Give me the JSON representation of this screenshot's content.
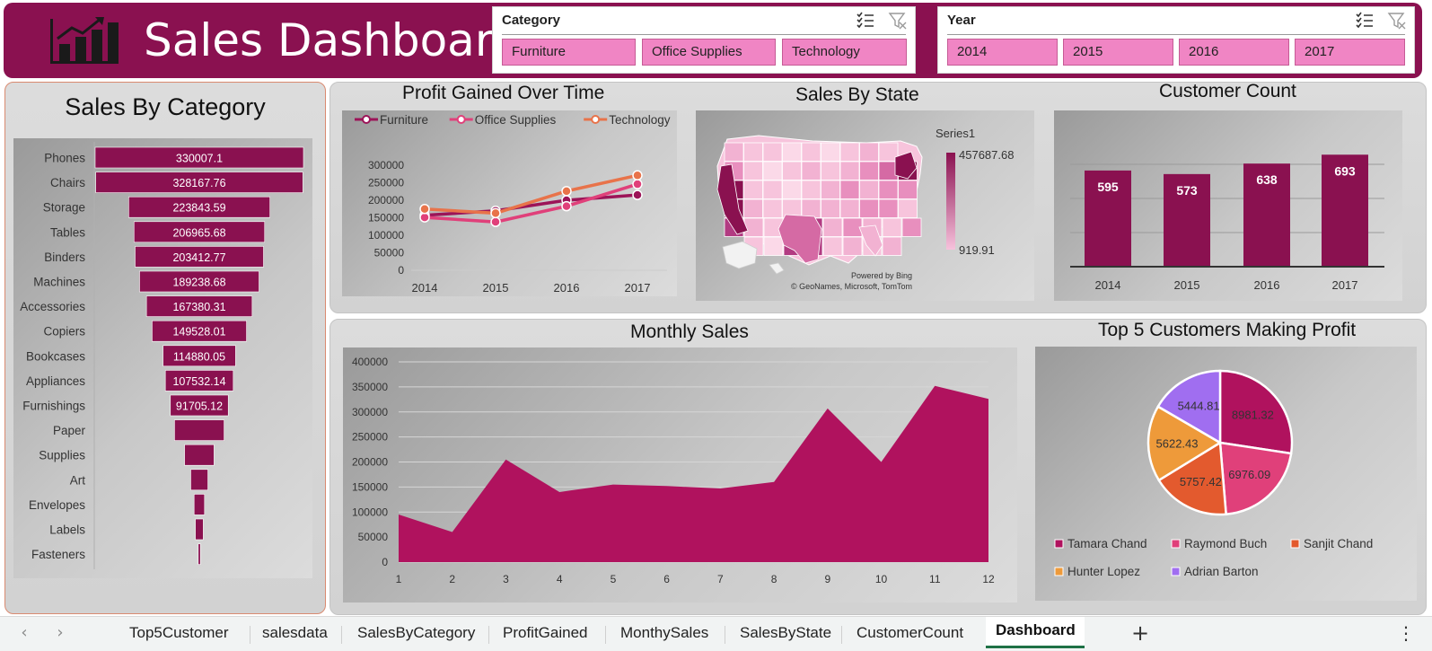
{
  "header": {
    "title": "Sales Dashboard",
    "brand_color": "#8a1150",
    "logo_icon": "bar-chart-trend-icon"
  },
  "slicers": {
    "category": {
      "title": "Category",
      "items": [
        "Furniture",
        "Office Supplies",
        "Technology"
      ],
      "icons": [
        "multi-select-icon",
        "clear-filter-icon"
      ]
    },
    "year": {
      "title": "Year",
      "items": [
        "2014",
        "2015",
        "2016",
        "2017"
      ],
      "icons": [
        "multi-select-icon",
        "clear-filter-icon"
      ]
    }
  },
  "charts": {
    "sales_by_category": {
      "title": "Sales By Category"
    },
    "profit_over_time": {
      "title": "Profit Gained Over Time"
    },
    "sales_by_state": {
      "title": "Sales By State",
      "legend_title": "Series1",
      "legend_max": "457687.68",
      "legend_min": "919.91",
      "credit_1": "Powered by Bing",
      "credit_2": "© GeoNames, Microsoft, TomTom"
    },
    "customer_count": {
      "title": "Customer Count"
    },
    "monthly_sales": {
      "title": "Monthly Sales"
    },
    "top5_customers": {
      "title": "Top 5 Customers Making Profit"
    }
  },
  "chart_data": [
    {
      "type": "bar",
      "title": "Sales By Category",
      "orientation": "horizontal-funnel",
      "categories": [
        "Phones",
        "Chairs",
        "Storage",
        "Tables",
        "Binders",
        "Machines",
        "Accessories",
        "Copiers",
        "Bookcases",
        "Appliances",
        "Furnishings",
        "Paper",
        "Supplies",
        "Art",
        "Envelopes",
        "Labels",
        "Fasteners"
      ],
      "values": [
        330007.1,
        328167.76,
        223843.59,
        206965.68,
        203412.77,
        189238.68,
        167380.31,
        149528.01,
        114880.05,
        107532.14,
        91705.12,
        78479,
        46674,
        27119,
        16476,
        12486,
        3024
      ],
      "data_labels": [
        "330007.1",
        "328167.76",
        "223843.59",
        "206965.68",
        "203412.77",
        "189238.68",
        "167380.31",
        "149528.01",
        "114880.05",
        "107532.14",
        "91705.12"
      ],
      "color": "#8a1150"
    },
    {
      "type": "line",
      "title": "Profit Gained Over Time",
      "categories": [
        "2014",
        "2015",
        "2016",
        "2017"
      ],
      "series": [
        {
          "name": "Furniture",
          "values": [
            157000,
            170000,
            200000,
            215000
          ],
          "color": "#9c1458"
        },
        {
          "name": "Office Supplies",
          "values": [
            151000,
            138000,
            183000,
            246000
          ],
          "color": "#e0407a"
        },
        {
          "name": "Technology",
          "values": [
            175000,
            163000,
            226000,
            271000
          ],
          "color": "#e8734a"
        }
      ],
      "ylim": [
        0,
        300000
      ],
      "yticks": [
        "300000",
        "250000",
        "200000",
        "150000",
        "100000",
        "50000",
        "0"
      ],
      "legend": "top"
    },
    {
      "type": "bar",
      "title": "Customer Count",
      "categories": [
        "2014",
        "2015",
        "2016",
        "2017"
      ],
      "values": [
        595,
        573,
        638,
        693
      ],
      "color": "#8a1150"
    },
    {
      "type": "area",
      "title": "Monthly Sales",
      "x": [
        "1",
        "2",
        "3",
        "4",
        "5",
        "6",
        "7",
        "8",
        "9",
        "10",
        "11",
        "12"
      ],
      "values": [
        95000,
        60000,
        205000,
        140000,
        155000,
        152000,
        147000,
        160000,
        307000,
        200000,
        352000,
        326000
      ],
      "ylim": [
        0,
        400000
      ],
      "yticks": [
        "400000",
        "350000",
        "300000",
        "250000",
        "200000",
        "150000",
        "100000",
        "50000",
        "0"
      ],
      "color": "#b0125e"
    },
    {
      "type": "pie",
      "title": "Top 5 Customers Making Profit",
      "labels": [
        "Tamara Chand",
        "Raymond Buch",
        "Sanjit Chand",
        "Hunter Lopez",
        "Adrian Barton"
      ],
      "values": [
        8981.32,
        6976.09,
        5757.42,
        5622.43,
        5444.81
      ],
      "data_labels": [
        "8981.32",
        "6976.09",
        "5757.42",
        "5622.43",
        "5444.81"
      ],
      "colors": [
        "#b0125e",
        "#e0407a",
        "#e35a2e",
        "#ee9a3a",
        "#a06ef0"
      ],
      "legend": "bottom"
    }
  ],
  "sheet_tabs": {
    "items": [
      "Top5Customer",
      "salesdata",
      "SalesByCategory",
      "ProfitGained",
      "MonthySales",
      "SalesByState",
      "CustomerCount",
      "Dashboard"
    ],
    "active": "Dashboard",
    "add_label": "+",
    "more_label": "⋮",
    "prev_label": "‹",
    "next_label": "›"
  }
}
